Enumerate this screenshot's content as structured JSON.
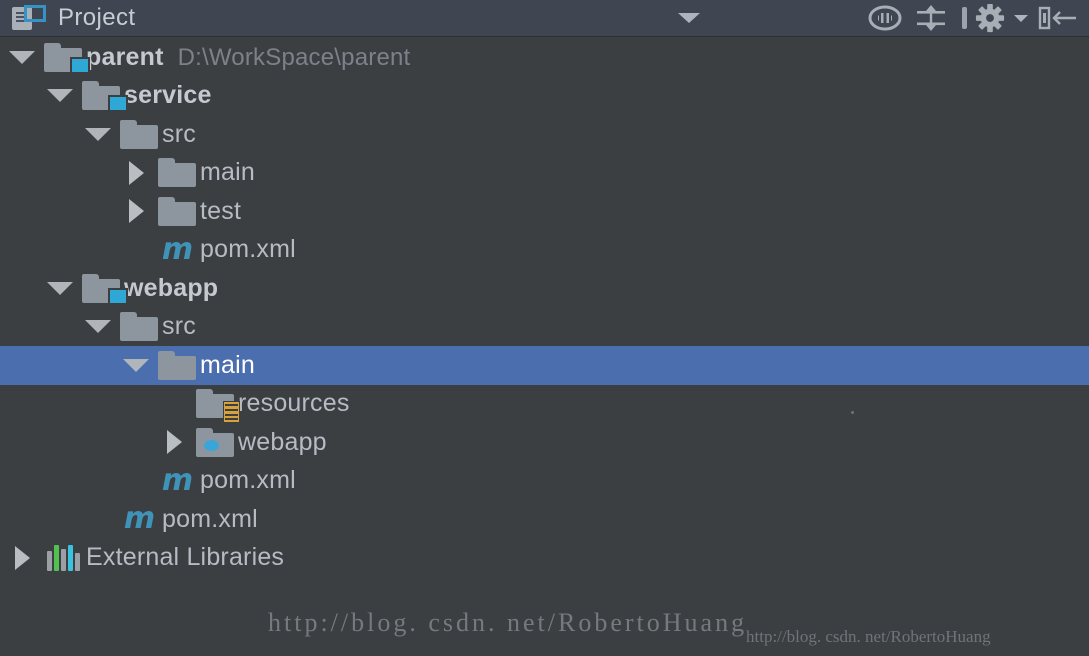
{
  "header": {
    "title": "Project",
    "panel_icon": "project-panel-icon",
    "toolbar": [
      {
        "name": "view-options-chevron",
        "icon": "chevron-down-icon"
      },
      {
        "name": "select-opened-file-button",
        "icon": "locate-target-icon"
      },
      {
        "name": "collapse-all-button",
        "icon": "collapse-all-icon"
      },
      {
        "name": "toolbar-separator",
        "icon": "vertical-separator"
      },
      {
        "name": "settings-button",
        "icon": "gear-icon"
      },
      {
        "name": "settings-dropdown",
        "icon": "chevron-down-small-icon"
      },
      {
        "name": "hide-panel-button",
        "icon": "hide-left-icon"
      }
    ]
  },
  "tree": {
    "rows": [
      {
        "label": "parent",
        "path": "D:\\WorkSpace\\parent",
        "icon": "module-folder-icon",
        "toggle": "expanded",
        "indent": 0,
        "bold": true,
        "selected": false
      },
      {
        "label": "service",
        "path": "",
        "icon": "module-folder-icon",
        "toggle": "expanded",
        "indent": 1,
        "bold": true,
        "selected": false
      },
      {
        "label": "src",
        "path": "",
        "icon": "folder-icon",
        "toggle": "expanded",
        "indent": 2,
        "bold": false,
        "selected": false
      },
      {
        "label": "main",
        "path": "",
        "icon": "folder-icon",
        "toggle": "collapsed",
        "indent": 3,
        "bold": false,
        "selected": false
      },
      {
        "label": "test",
        "path": "",
        "icon": "folder-icon",
        "toggle": "collapsed",
        "indent": 3,
        "bold": false,
        "selected": false
      },
      {
        "label": "pom.xml",
        "path": "",
        "icon": "maven-file-icon",
        "toggle": "none",
        "indent": 3,
        "bold": false,
        "selected": false
      },
      {
        "label": "webapp",
        "path": "",
        "icon": "module-folder-icon",
        "toggle": "expanded",
        "indent": 1,
        "bold": true,
        "selected": false
      },
      {
        "label": "src",
        "path": "",
        "icon": "folder-icon",
        "toggle": "expanded",
        "indent": 2,
        "bold": false,
        "selected": false
      },
      {
        "label": "main",
        "path": "",
        "icon": "folder-icon",
        "toggle": "expanded",
        "indent": 3,
        "bold": false,
        "selected": true
      },
      {
        "label": "resources",
        "path": "",
        "icon": "resources-folder-icon",
        "toggle": "none",
        "indent": 4,
        "bold": false,
        "selected": false
      },
      {
        "label": "webapp",
        "path": "",
        "icon": "web-folder-icon",
        "toggle": "collapsed",
        "indent": 4,
        "bold": false,
        "selected": false
      },
      {
        "label": "pom.xml",
        "path": "",
        "icon": "maven-file-icon",
        "toggle": "none",
        "indent": 3,
        "bold": false,
        "selected": false
      },
      {
        "label": "pom.xml",
        "path": "",
        "icon": "maven-file-icon",
        "toggle": "none",
        "indent": 2,
        "bold": false,
        "selected": false
      },
      {
        "label": "External Libraries",
        "path": "",
        "icon": "libraries-icon",
        "toggle": "collapsed",
        "indent": 0,
        "bold": false,
        "selected": false
      }
    ]
  },
  "watermarks": {
    "primary": "http://blog. csdn. net/RobertoHuang",
    "secondary": "http://blog. csdn. net/RobertoHuang"
  },
  "colors": {
    "header_bg": "#3f4652",
    "tree_bg": "#3c3f41",
    "selection_bg": "#4b6eaf",
    "text": "#b6bcc4",
    "muted_text": "#7b828c",
    "accent_cyan": "#2fa8d6",
    "maven_blue": "#3f93b8",
    "resources_orange": "#d8a13a",
    "lib_green": "#53c14f"
  }
}
